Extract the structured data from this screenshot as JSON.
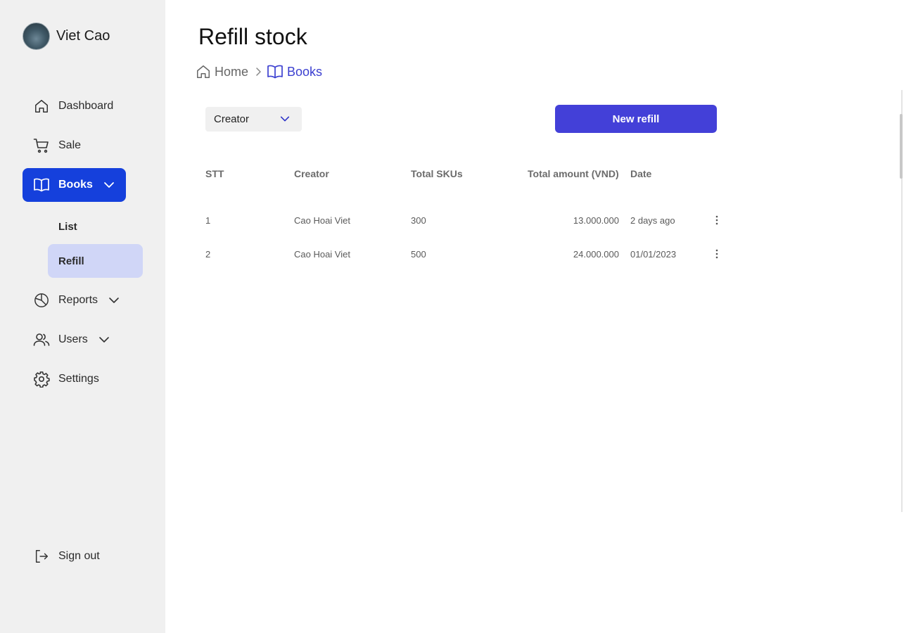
{
  "profile": {
    "name": "Viet Cao"
  },
  "sidebar": {
    "items": [
      {
        "label": "Dashboard",
        "icon": "home-icon"
      },
      {
        "label": "Sale",
        "icon": "cart-icon"
      },
      {
        "label": "Books",
        "icon": "book-open-icon",
        "active": true,
        "expanded": true
      },
      {
        "label": "Reports",
        "icon": "pie-chart-icon"
      },
      {
        "label": "Users",
        "icon": "users-icon"
      },
      {
        "label": "Settings",
        "icon": "gear-icon"
      }
    ],
    "books_sub": [
      {
        "label": "List"
      },
      {
        "label": "Refill",
        "active": true
      }
    ],
    "signout": {
      "label": "Sign out",
      "icon": "sign-out-icon"
    }
  },
  "header": {
    "title": "Refill stock",
    "breadcrumb": [
      {
        "label": "Home",
        "icon": "home-icon"
      },
      {
        "label": "Books",
        "icon": "book-open-icon"
      }
    ]
  },
  "toolbar": {
    "filter_label": "Creator",
    "new_button_label": "New refill"
  },
  "table": {
    "columns": [
      "STT",
      "Creator",
      "Total SKUs",
      "Total amount (VND)",
      "Date"
    ],
    "rows": [
      {
        "stt": "1",
        "creator": "Cao Hoai Viet",
        "skus": "300",
        "amount": "13.000.000",
        "date": "2 days ago"
      },
      {
        "stt": "2",
        "creator": "Cao Hoai Viet",
        "skus": "500",
        "amount": "24.000.000",
        "date": "01/01/2023"
      }
    ]
  },
  "colors": {
    "sidebar_bg": "#f0f0f0",
    "active_nav": "#1540dc",
    "active_sub": "#d0d6f7",
    "primary_button": "#4340d8",
    "breadcrumb_current": "#3b3fd0"
  }
}
